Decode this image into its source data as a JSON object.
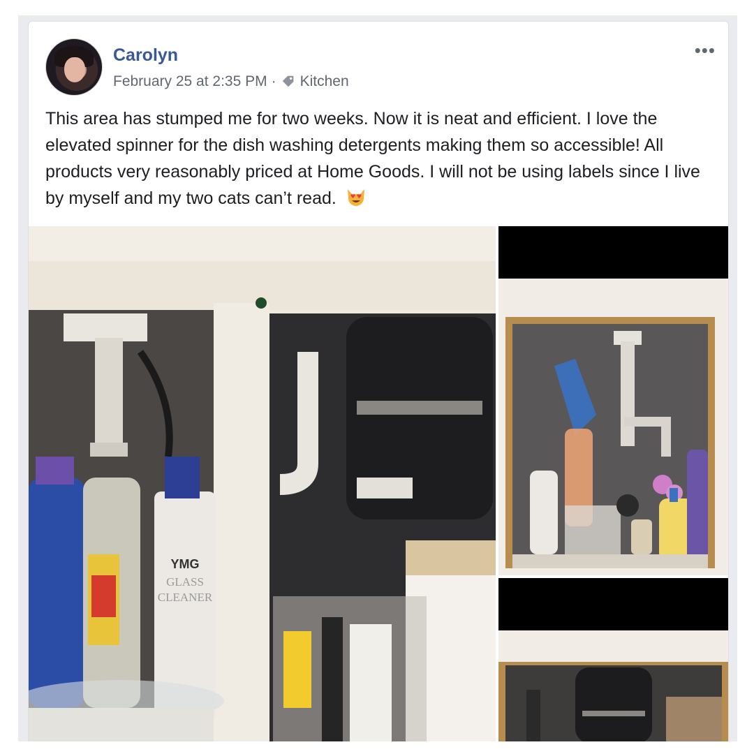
{
  "post": {
    "author": "Carolyn",
    "date": "February 25 at 2:35 PM",
    "separator": "·",
    "tag": "Kitchen",
    "more_label": "•••",
    "text": "This area has stumped me for two weeks. Now it is neat and efficient. I love the elevated spinner for the dish washing detergents making them so accessible! All products very reasonably priced at Home Goods. I will not be using labels since I live by myself and my two cats can’t read."
  },
  "photos": {
    "main": {
      "label_brand": "YMG",
      "label_product_1": "GLASS",
      "label_product_2": "CLEANER"
    }
  },
  "colors": {
    "author": "#385898",
    "meta": "#616770",
    "text": "#1c1e21",
    "page_bg": "#e9ebee"
  },
  "icons": {
    "tag": "tag-icon",
    "emoji": "heart-eyes-cat-emoji",
    "more": "more-options-icon"
  }
}
